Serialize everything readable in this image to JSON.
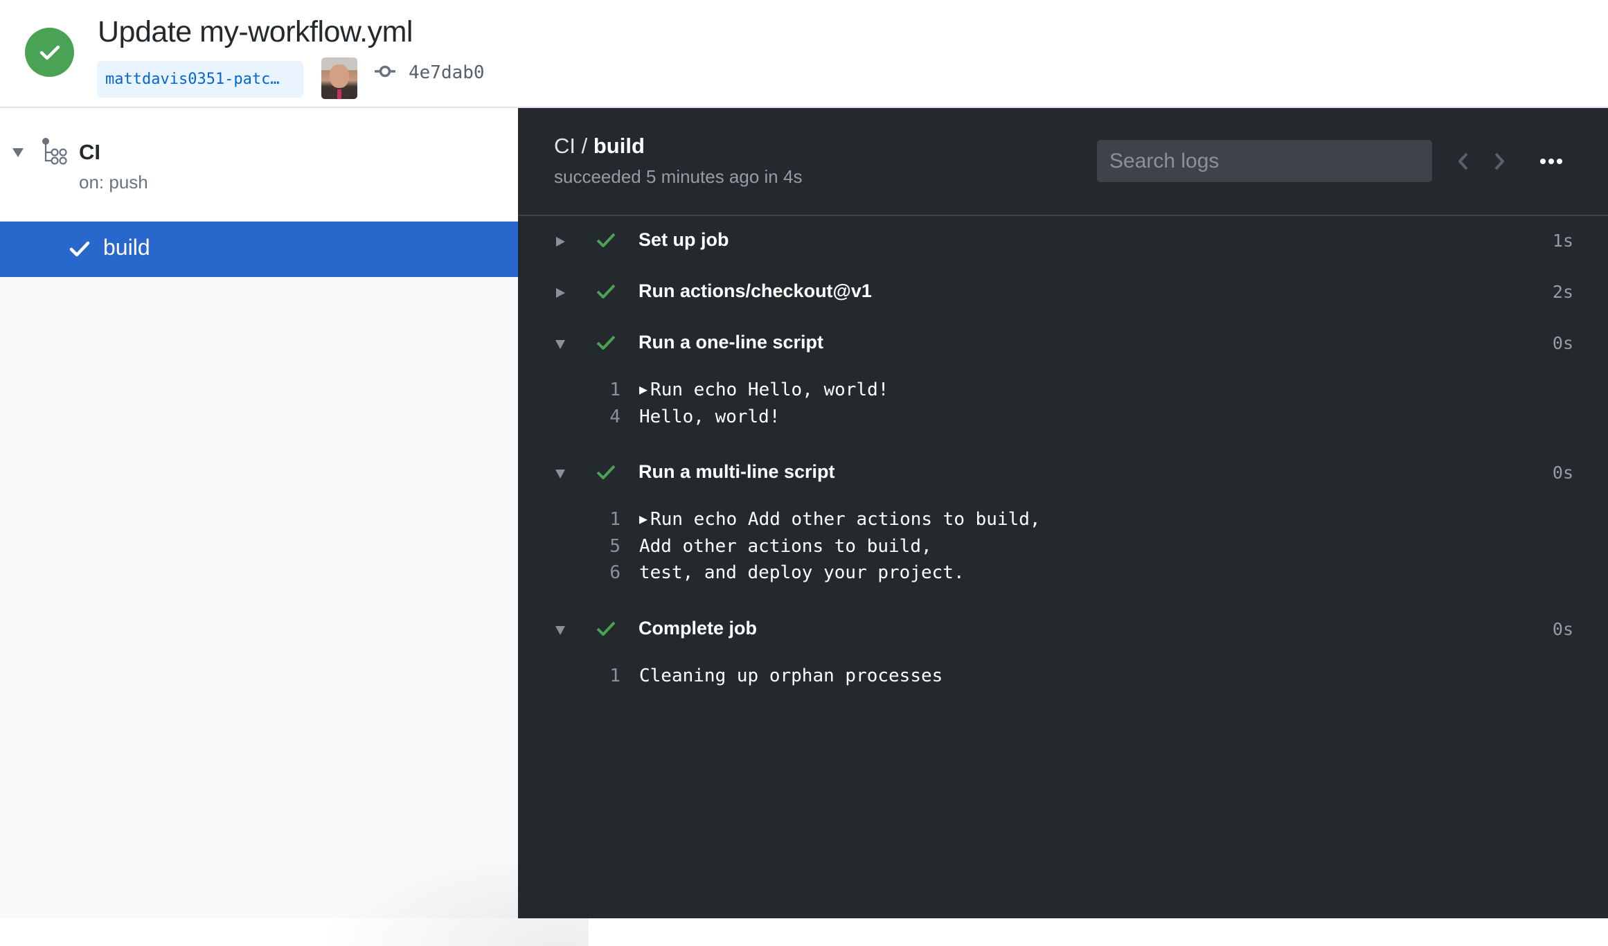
{
  "header": {
    "status": "success",
    "status_color": "#4aa254",
    "title": "Update my-workflow.yml",
    "branch": "mattdavis0351-patc…",
    "commit_icon": "git-commit-icon",
    "commit_sha": "4e7dab0",
    "avatar_alt": "author avatar"
  },
  "sidebar": {
    "workflow": {
      "name": "CI",
      "trigger": "on: push",
      "icon": "workflow-icon",
      "expanded": true
    },
    "jobs": [
      {
        "name": "build",
        "status": "success",
        "selected": true,
        "selected_color": "#2868cc"
      }
    ]
  },
  "log_panel": {
    "workflow_name": "CI",
    "separator": " / ",
    "job_name": "build",
    "summary": "succeeded 5 minutes ago in 4s",
    "search": {
      "placeholder": "Search logs",
      "value": ""
    },
    "prev_icon": "chevron-left-icon",
    "next_icon": "chevron-right-icon",
    "menu_icon": "kebab-horizontal-icon",
    "success_color": "#4aa254",
    "steps": [
      {
        "name": "Set up job",
        "duration": "1s",
        "expanded": false,
        "status": "success",
        "lines": []
      },
      {
        "name": "Run actions/checkout@v1",
        "duration": "2s",
        "expanded": false,
        "status": "success",
        "lines": []
      },
      {
        "name": "Run a one-line script",
        "duration": "0s",
        "expanded": true,
        "status": "success",
        "lines": [
          {
            "no": "1",
            "text": "Run echo Hello, world!",
            "collapsible": true
          },
          {
            "no": "4",
            "text": "Hello, world!",
            "collapsible": false
          }
        ]
      },
      {
        "name": "Run a multi-line script",
        "duration": "0s",
        "expanded": true,
        "status": "success",
        "lines": [
          {
            "no": "1",
            "text": "Run echo Add other actions to build,",
            "collapsible": true
          },
          {
            "no": "5",
            "text": "Add other actions to build,",
            "collapsible": false
          },
          {
            "no": "6",
            "text": "test, and deploy your project.",
            "collapsible": false
          }
        ]
      },
      {
        "name": "Complete job",
        "duration": "0s",
        "expanded": true,
        "status": "success",
        "lines": [
          {
            "no": "1",
            "text": "Cleaning up orphan processes",
            "collapsible": false
          }
        ]
      }
    ]
  }
}
